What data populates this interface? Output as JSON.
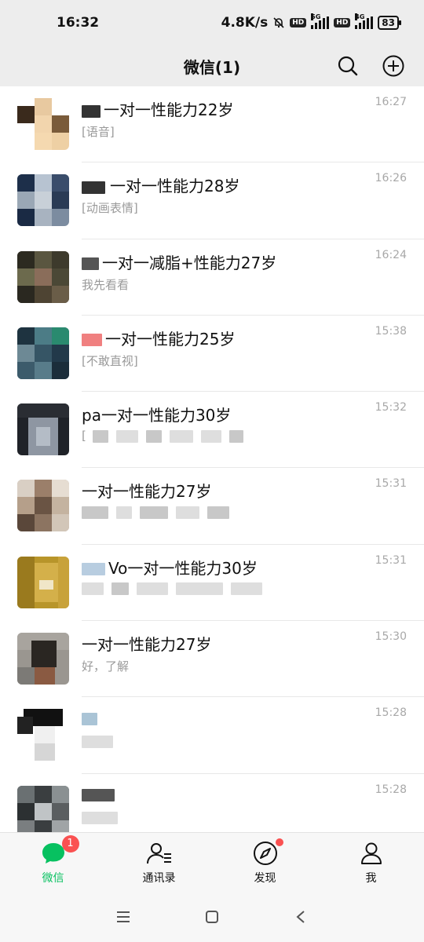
{
  "status_bar": {
    "time": "16:32",
    "net_speed": "4.8K/s",
    "hd1": "HD",
    "net1": "5G",
    "hd2": "HD",
    "net2": "4G",
    "battery": "83"
  },
  "nav": {
    "title": "微信(1)",
    "search_icon": "search-icon",
    "add_icon": "plus-circle-icon"
  },
  "chats": [
    {
      "name": "一对一性能力22岁",
      "preview": "[语音]",
      "time": "16:27"
    },
    {
      "name": "一对一性能力28岁",
      "preview": "[动画表情]",
      "time": "16:26"
    },
    {
      "name": "一对一减脂+性能力27岁",
      "preview": "我先看看",
      "time": "16:24"
    },
    {
      "name": "一对一性能力25岁",
      "preview": "[不敢直视]",
      "time": "15:38"
    },
    {
      "name": "pa一对一性能力30岁",
      "preview": "[",
      "time": "15:32"
    },
    {
      "name": "一对一性能力27岁",
      "preview": "",
      "time": "15:31"
    },
    {
      "name": "Vo一对一性能力30岁",
      "preview": "",
      "time": "15:31"
    },
    {
      "name": "一对一性能力27岁",
      "preview": "好，了解",
      "time": "15:30"
    },
    {
      "name": "",
      "preview": "",
      "time": "15:28"
    },
    {
      "name": "",
      "preview": "",
      "time": "15:28"
    }
  ],
  "tabs": [
    {
      "label": "微信",
      "icon": "chat-bubble-icon",
      "badge": "1"
    },
    {
      "label": "通讯录",
      "icon": "contacts-icon"
    },
    {
      "label": "发现",
      "icon": "compass-icon"
    },
    {
      "label": "我",
      "icon": "person-icon"
    }
  ],
  "colors": {
    "accent": "#07c160",
    "badge": "#fa5151",
    "bar_bg": "#ededed"
  }
}
